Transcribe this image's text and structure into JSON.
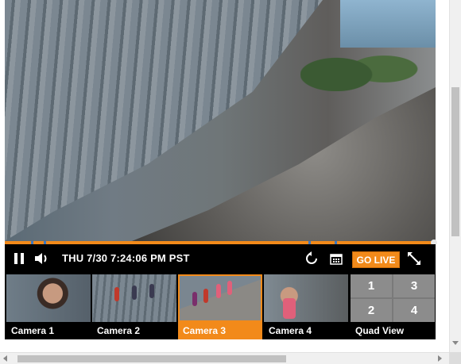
{
  "player": {
    "progress": {
      "played_fraction": 0.996,
      "marker_fractions": [
        0.06,
        0.09,
        0.705,
        0.765
      ]
    },
    "controls": {
      "datetime": "THU 7/30 7:24:06 PM PST",
      "go_live_label": "GO LIVE",
      "icons": [
        "pause-icon",
        "volume-icon",
        "replay-icon",
        "calendar-icon",
        "fullscreen-icon"
      ]
    },
    "cameras": [
      {
        "label": "Camera 1",
        "active": false
      },
      {
        "label": "Camera 2",
        "active": false
      },
      {
        "label": "Camera 3",
        "active": true
      },
      {
        "label": "Camera 4",
        "active": false
      }
    ],
    "quad_view": {
      "label": "Quad View",
      "cells": [
        "1",
        "3",
        "2",
        "4"
      ]
    }
  },
  "colors": {
    "accent": "#f28a1a",
    "bar_bg": "#000000"
  }
}
